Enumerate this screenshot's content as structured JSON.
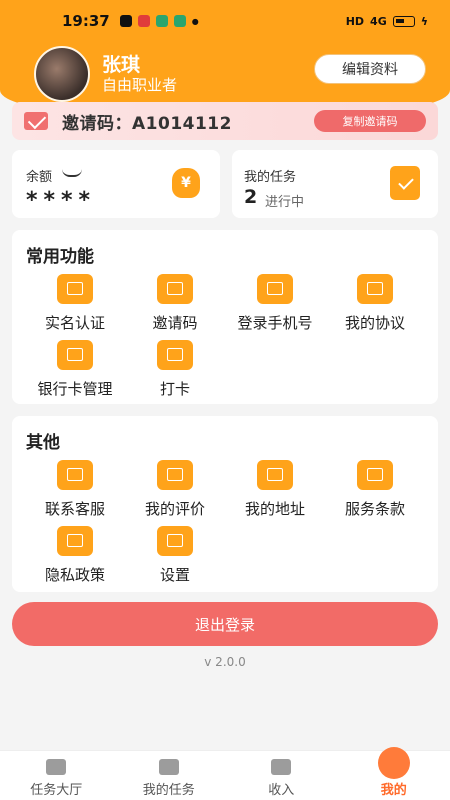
{
  "status_bar": {
    "time": "19:37",
    "network": "HD",
    "signal": "4G"
  },
  "profile": {
    "name": "张琪",
    "job": "自由职业者",
    "edit_label": "编辑资料"
  },
  "invite": {
    "text": "邀请码：A1014112",
    "copy_label": "复制邀请码"
  },
  "balance": {
    "label": "余额",
    "value": "****"
  },
  "task": {
    "label": "我的任务",
    "count": "2",
    "status": "进行中"
  },
  "common": {
    "title": "常用功能",
    "items": [
      {
        "label": "实名认证",
        "icon": "id-card-icon"
      },
      {
        "label": "邀请码",
        "icon": "envelope-icon"
      },
      {
        "label": "登录手机号",
        "icon": "phone-icon"
      },
      {
        "label": "我的协议",
        "icon": "document-icon"
      },
      {
        "label": "银行卡管理",
        "icon": "bank-card-icon"
      },
      {
        "label": "打卡",
        "icon": "calendar-check-icon"
      }
    ]
  },
  "other": {
    "title": "其他",
    "items": [
      {
        "label": "联系客服",
        "icon": "headset-icon"
      },
      {
        "label": "我的评价",
        "icon": "chat-icon"
      },
      {
        "label": "我的地址",
        "icon": "location-icon"
      },
      {
        "label": "服务条款",
        "icon": "terms-icon"
      },
      {
        "label": "隐私政策",
        "icon": "privacy-icon"
      },
      {
        "label": "设置",
        "icon": "settings-icon"
      }
    ]
  },
  "logout_label": "退出登录",
  "version": "v 2.0.0",
  "nav": [
    {
      "label": "任务大厅",
      "icon": "home-icon"
    },
    {
      "label": "我的任务",
      "icon": "task-icon"
    },
    {
      "label": "收入",
      "icon": "money-bag-icon"
    },
    {
      "label": "我的",
      "icon": "profile-icon"
    }
  ],
  "colors": {
    "primary": "#ffa31a",
    "danger": "#f26b67",
    "active_nav": "#ff6a2a"
  }
}
